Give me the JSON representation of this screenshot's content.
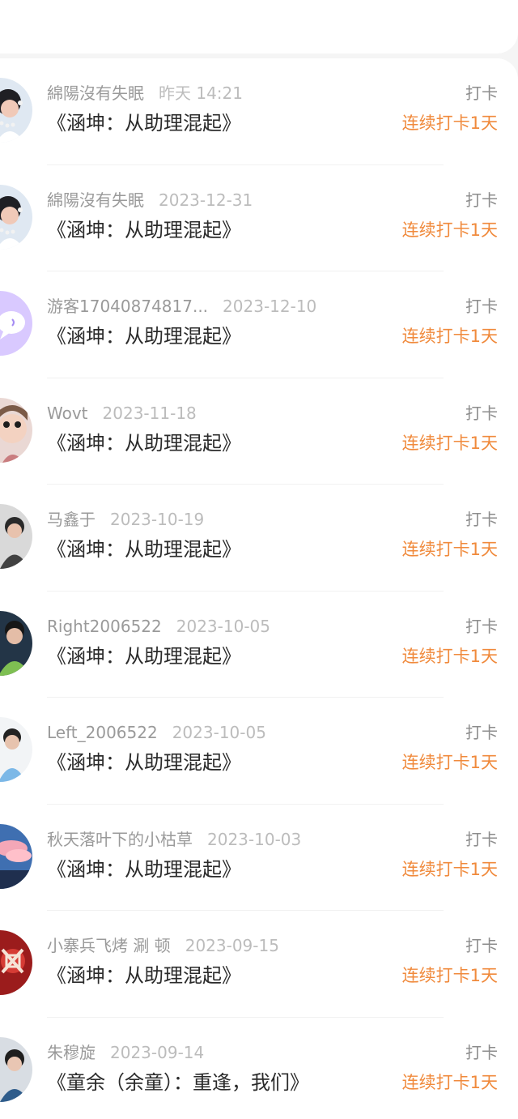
{
  "records": [
    {
      "username": "綿陽沒有失眠",
      "date": "昨天 14:21",
      "book": "《涵坤：从助理混起》",
      "action": "打卡",
      "streak": "连续打卡1天",
      "avatar_icon": "avatar-woman-pearls-icon"
    },
    {
      "username": "綿陽沒有失眠",
      "date": "2023-12-31",
      "book": "《涵坤：从助理混起》",
      "action": "打卡",
      "streak": "连续打卡1天",
      "avatar_icon": "avatar-woman-pearls-icon"
    },
    {
      "username": "游客17040874817...",
      "date": "2023-12-10",
      "book": "《涵坤：从助理混起》",
      "action": "打卡",
      "streak": "连续打卡1天",
      "avatar_icon": "avatar-chat-bubble-icon"
    },
    {
      "username": "Wovt",
      "date": "2023-11-18",
      "book": "《涵坤：从助理混起》",
      "action": "打卡",
      "streak": "连续打卡1天",
      "avatar_icon": "avatar-doll-icon"
    },
    {
      "username": "马鑫于",
      "date": "2023-10-19",
      "book": "《涵坤：从助理混起》",
      "action": "打卡",
      "streak": "连续打卡1天",
      "avatar_icon": "avatar-person-icon"
    },
    {
      "username": "Right2006522",
      "date": "2023-10-05",
      "book": "《涵坤：从助理混起》",
      "action": "打卡",
      "streak": "连续打卡1天",
      "avatar_icon": "avatar-person-icon"
    },
    {
      "username": "Left_2006522",
      "date": "2023-10-05",
      "book": "《涵坤：从助理混起》",
      "action": "打卡",
      "streak": "连续打卡1天",
      "avatar_icon": "avatar-person-icon"
    },
    {
      "username": "秋天落叶下的小枯草",
      "date": "2023-10-03",
      "book": "《涵坤：从助理混起》",
      "action": "打卡",
      "streak": "连续打卡1天",
      "avatar_icon": "avatar-sky-icon"
    },
    {
      "username": "小寨兵飞烤 涮 顿",
      "date": "2023-09-15",
      "book": "《涵坤：从助理混起》",
      "action": "打卡",
      "streak": "连续打卡1天",
      "avatar_icon": "avatar-red-pattern-icon"
    },
    {
      "username": "朱穆旋",
      "date": "2023-09-14",
      "book": "《童余（余童）：重逢，我们》",
      "action": "打卡",
      "streak": "连续打卡1天",
      "avatar_icon": "avatar-person-icon"
    }
  ]
}
